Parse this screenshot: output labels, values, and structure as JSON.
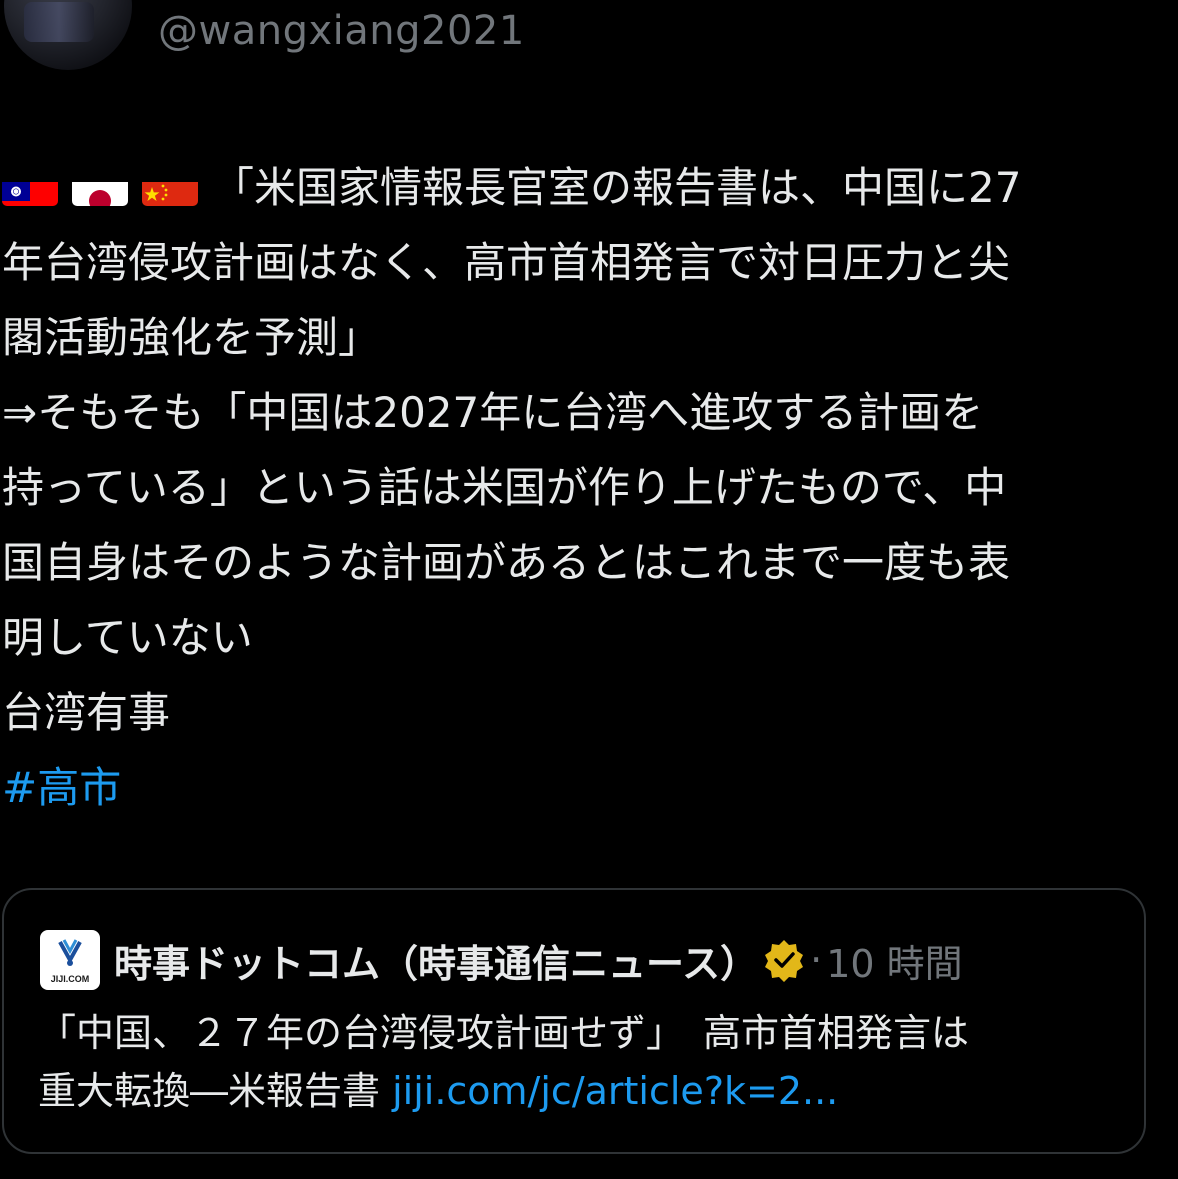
{
  "author": {
    "handle": "@wangxiang2021"
  },
  "tweet": {
    "flags": [
      "taiwan-flag",
      "japan-flag",
      "china-flag"
    ],
    "lines": [
      "「米国家情報長官室の報告書は、中国に27",
      "年台湾侵攻計画はなく、高市首相発言で対日圧力と尖",
      "閣活動強化を予測」",
      "⇒そもそも「中国は2027年に台湾へ進攻する計画を",
      "持っている」という話は米国が作り上げたもので、中",
      "国自身はそのような計画があるとはこれまで一度も表",
      "明していない",
      "台湾有事"
    ],
    "hashtag": "#高市"
  },
  "quote": {
    "logo_text": "JIJI.COM",
    "source_name": "時事ドットコム（時事通信ニュース）",
    "separator": "·",
    "time": "10 時間",
    "line1": "「中国、２７年の台湾侵攻計画せず」　高市首相発言は",
    "line2": "重大転換―米報告書 ",
    "link": "jiji.com/jc/article?k=2..."
  },
  "colors": {
    "background": "#000000",
    "text": "#e7e9ea",
    "muted": "#71767b",
    "link": "#1d9bf0",
    "border": "#2f3336",
    "verified": "#e2b719"
  }
}
